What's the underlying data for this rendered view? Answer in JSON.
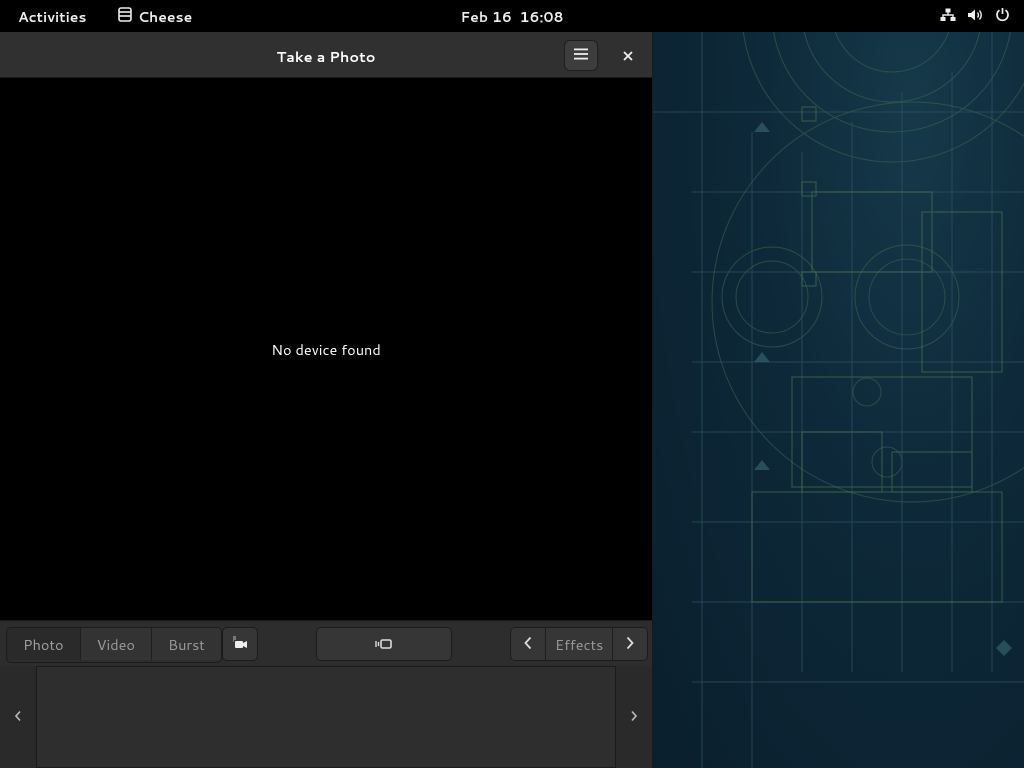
{
  "topbar": {
    "activities": "Activities",
    "app_name": "Cheese",
    "app_icon": "cheese-app-icon",
    "date": "Feb 16",
    "time": "16:08",
    "system_icons": [
      "network-icon",
      "volume-icon",
      "power-icon"
    ]
  },
  "window": {
    "title": "Take a Photo",
    "menu_icon": "hamburger-menu-icon",
    "close_icon": "close-icon",
    "viewport_message": "No device found"
  },
  "controls": {
    "modes": [
      {
        "label": "Photo",
        "active": true
      },
      {
        "label": "Video",
        "active": false
      },
      {
        "label": "Burst",
        "active": false
      }
    ],
    "camera_switch_icon": "camera-switch-icon",
    "take_photo_icon": "take-photo-icon",
    "effects_label": "Effects",
    "effects_prev_icon": "chevron-left-icon",
    "effects_next_icon": "chevron-right-icon"
  },
  "thumbnails": {
    "prev_icon": "chevron-left-icon",
    "next_icon": "chevron-right-icon",
    "items": []
  },
  "colors": {
    "topbar_bg": "#000000",
    "headerbar_bg": "#303030",
    "viewport_bg": "#000000",
    "window_bg": "#242424",
    "wallpaper_bg": "#0b2232"
  }
}
